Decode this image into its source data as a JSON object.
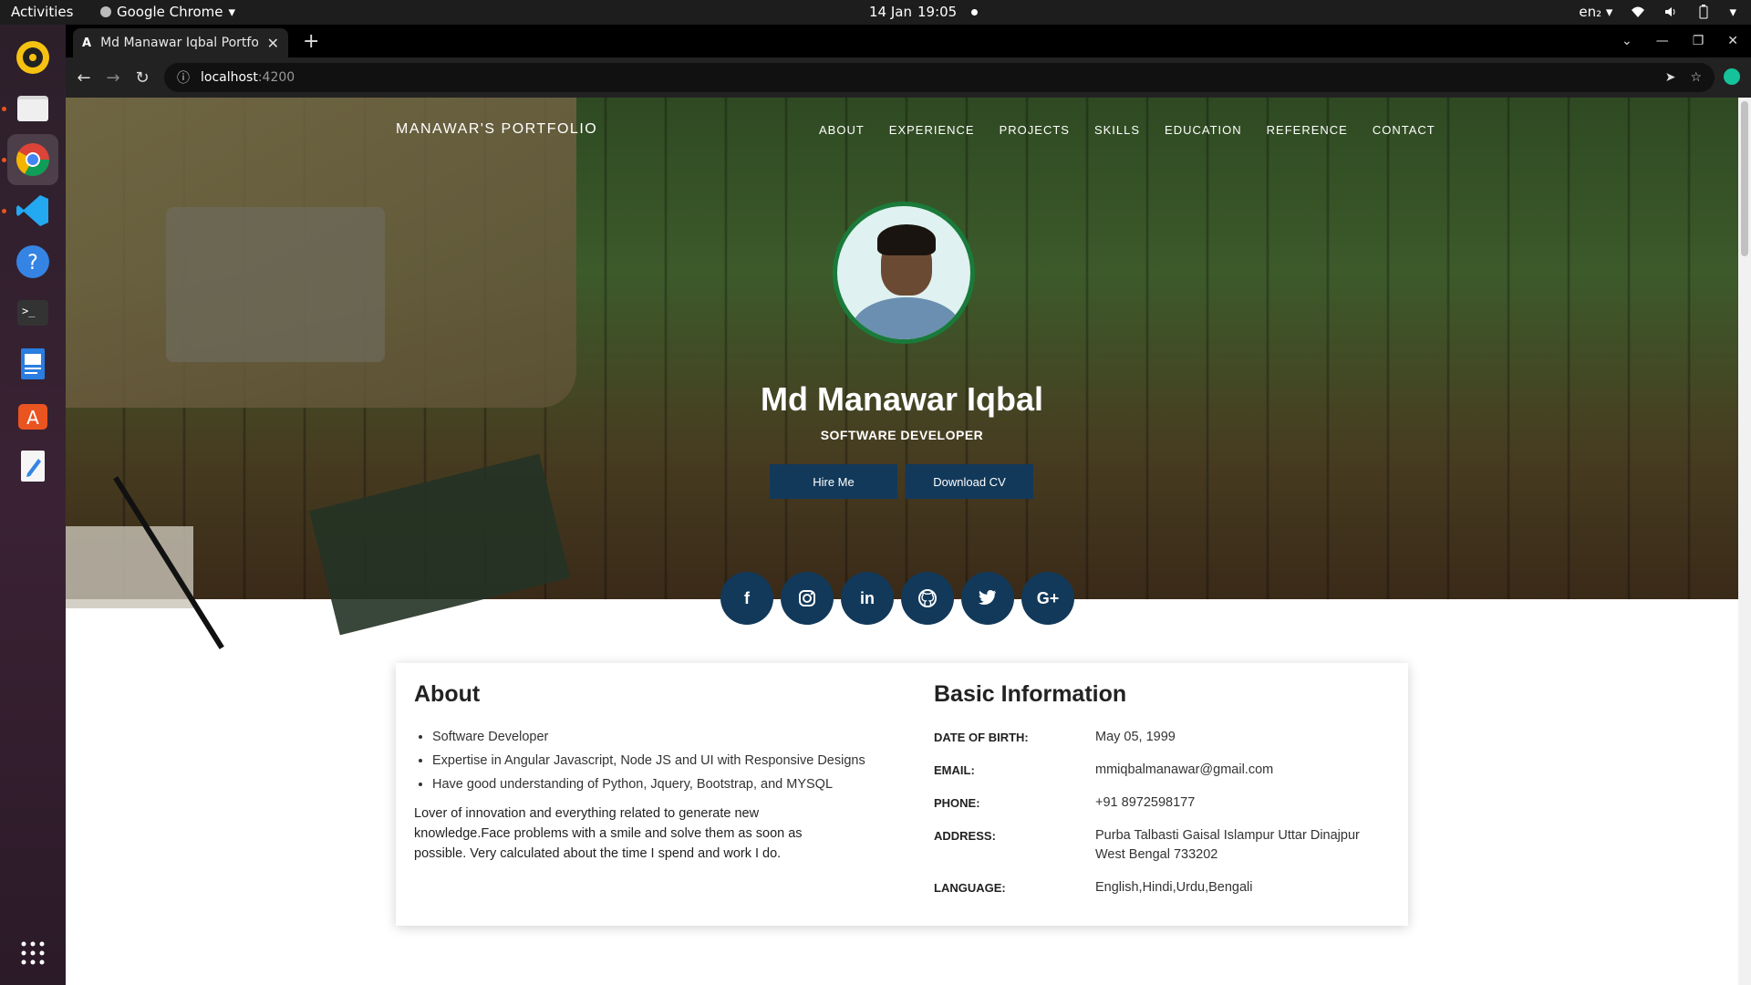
{
  "system": {
    "activities": "Activities",
    "app_name": "Google Chrome",
    "date": "14 Jan",
    "time": "19:05",
    "lang": "en₂"
  },
  "browser": {
    "tab_title": "Md Manawar Iqbal Portfo",
    "tab_favicon": "A",
    "url_host": "localhost",
    "url_port": ":4200"
  },
  "site": {
    "brand": "MANAWAR'S PORTFOLIO",
    "nav": [
      "ABOUT",
      "EXPERIENCE",
      "PROJECTS",
      "SKILLS",
      "EDUCATION",
      "REFERENCE",
      "CONTACT"
    ],
    "name": "Md Manawar Iqbal",
    "role": "SOFTWARE DEVELOPER",
    "hire_label": "Hire Me",
    "cv_label": "Download CV",
    "socials": [
      "f",
      "IG",
      "in",
      "GH",
      "tw",
      "G+"
    ],
    "accent": "#12395a"
  },
  "about": {
    "title": "About",
    "points": [
      "Software Developer",
      "Expertise in Angular Javascript, Node JS and UI with Responsive Designs",
      "Have good understanding of Python, Jquery, Bootstrap, and MYSQL"
    ],
    "paragraph": "Lover of innovation and everything related to generate new knowledge.Face problems with a smile and solve them as soon as possible. Very calculated about the time I spend and work I do."
  },
  "basic": {
    "title": "Basic Information",
    "rows": [
      {
        "key": "DATE OF BIRTH:",
        "value": "May 05, 1999"
      },
      {
        "key": "EMAIL:",
        "value": "mmiqbalmanawar@gmail.com"
      },
      {
        "key": "PHONE:",
        "value": "+91 8972598177"
      },
      {
        "key": "ADDRESS:",
        "value": "Purba Talbasti Gaisal Islampur Uttar Dinajpur West Bengal 733202"
      },
      {
        "key": "LANGUAGE:",
        "value": "English,Hindi,Urdu,Bengali"
      }
    ]
  }
}
